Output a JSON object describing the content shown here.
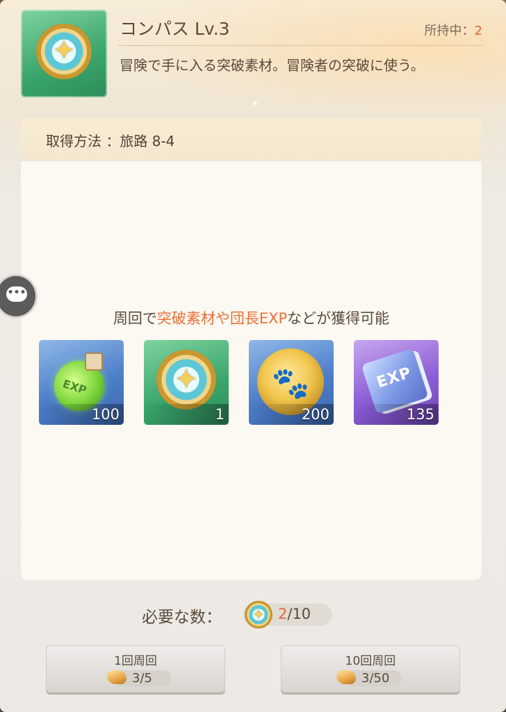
{
  "item": {
    "title": "コンパス Lv.3",
    "owned_label": "所持中：",
    "owned_count": "2",
    "description": "冒険で手に入る突破素材。冒険者の突破に使う。",
    "icon": "compass-icon"
  },
  "acquisition": {
    "label": "取得方法 ：旅路 8-4"
  },
  "rewards": {
    "caption_prefix": "周回で",
    "caption_highlight": "突破素材や団長EXP",
    "caption_suffix": "などが獲得可能",
    "items": [
      {
        "icon": "exp-potion-icon",
        "count": "100"
      },
      {
        "icon": "compass-icon",
        "count": "1"
      },
      {
        "icon": "paw-coin-icon",
        "count": "200"
      },
      {
        "icon": "exp-book-icon",
        "count": "135"
      }
    ],
    "potion_text": "EXP",
    "book_text": "EXP"
  },
  "requirement": {
    "label": "必要な数：",
    "have": "2",
    "need": "/10"
  },
  "buttons": [
    {
      "label": "1回周回",
      "cost": "3/5",
      "icon": "bread-icon"
    },
    {
      "label": "10回周回",
      "cost": "3/50",
      "icon": "bread-icon"
    }
  ],
  "chat_tab": {
    "glyph": "•••"
  },
  "colors": {
    "accent": "#e0662f",
    "highlight": "#ec6e35",
    "green_rarity": "#3aa56c",
    "blue_rarity": "#4d7ec9",
    "purple_rarity": "#8d5fd6"
  }
}
